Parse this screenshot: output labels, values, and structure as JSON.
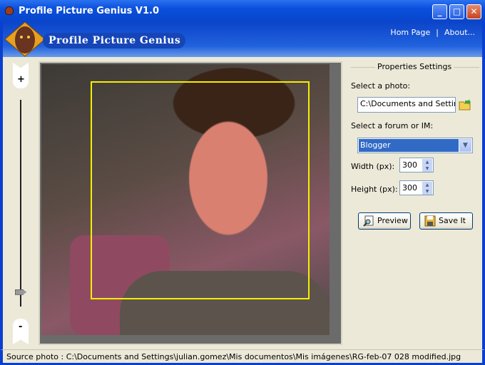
{
  "window": {
    "title": "Profile Picture Genius V1.0"
  },
  "header": {
    "logo_text": "Profile Picture Genius",
    "links": [
      "Hom Page",
      "About..."
    ],
    "separator": "|"
  },
  "zoom_slider": {
    "plus": "+",
    "minus": "-",
    "value_fraction": 0.07
  },
  "properties": {
    "title": "Properties Settings",
    "photo_label": "Select a photo:",
    "photo_value": "C:\\Documents and Settings",
    "forum_label": "Select a forum or IM:",
    "forum_value": "Blogger",
    "width_label": "Width (px):",
    "width_value": "300",
    "height_label": "Height (px):",
    "height_value": "300",
    "preview_label": "Preview",
    "save_label": "Save It"
  },
  "status": {
    "text": "Source photo : C:\\Documents and Settings\\julian.gomez\\Mis documentos\\Mis imágenes\\RG-feb-07 028 modified.jpg"
  },
  "colors": {
    "crop_box": "#f6ee00",
    "selection": "#316ac5"
  }
}
